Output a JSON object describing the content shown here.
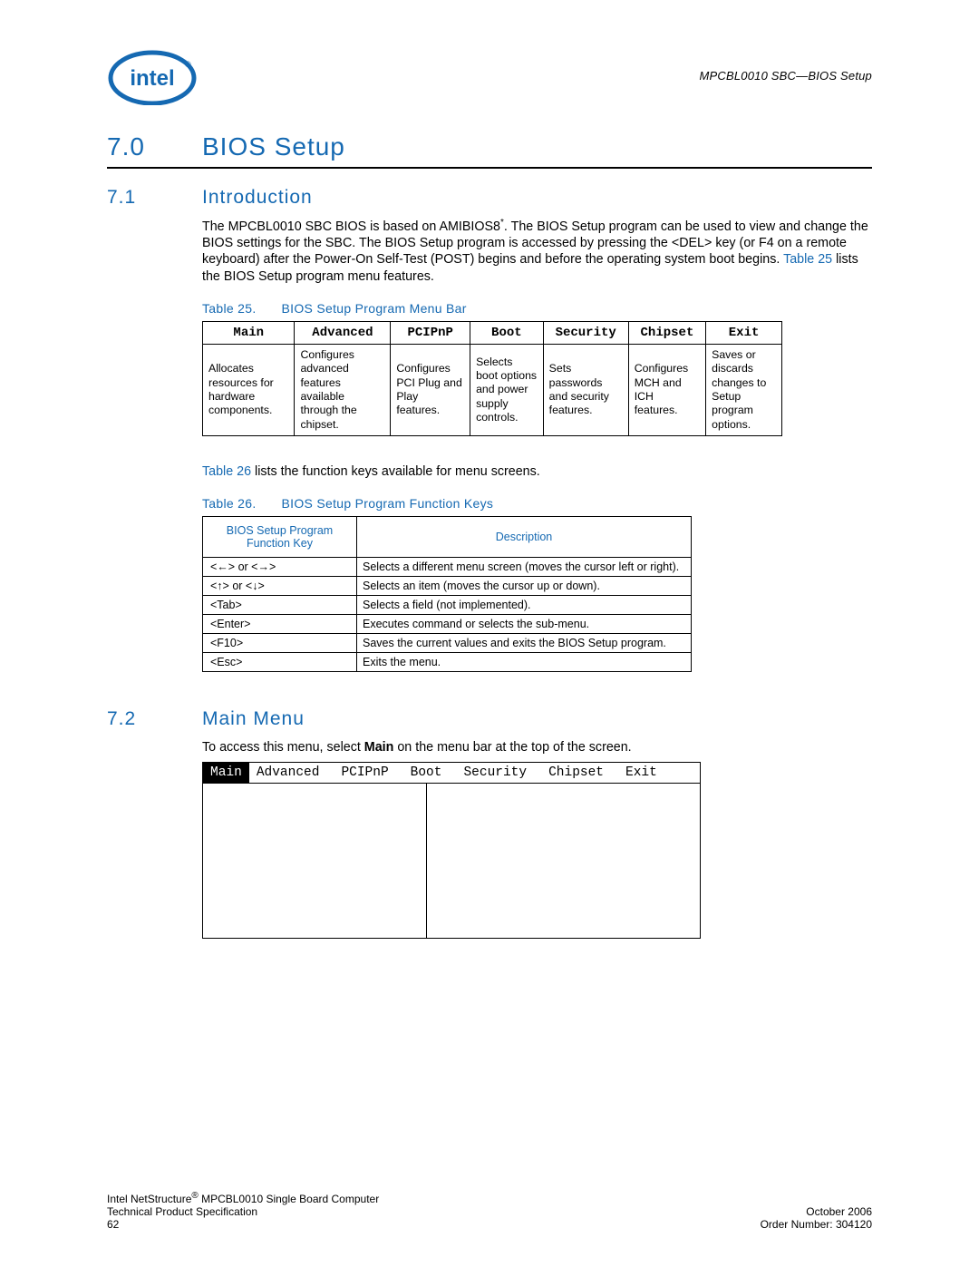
{
  "header": {
    "right": "MPCBL0010 SBC—BIOS Setup"
  },
  "h1": {
    "num": "7.0",
    "title": "BIOS Setup"
  },
  "sec71": {
    "num": "7.1",
    "title": "Introduction",
    "para_a": "The MPCBL0010 SBC BIOS is based on AMIBIOS8",
    "para_b": ". The BIOS Setup program can be used to view and change the BIOS settings for the SBC. The BIOS Setup program is accessed by pressing the <DEL> key (or F4 on a remote keyboard) after the Power-On Self-Test (POST) begins and before the operating system boot begins. ",
    "para_c": " lists the BIOS Setup program menu features.",
    "xref25": "Table 25",
    "sup": "*"
  },
  "table25": {
    "caption_num": "Table 25.",
    "caption_title": "BIOS Setup Program Menu Bar",
    "headers": [
      "Main",
      "Advanced",
      "PCIPnP",
      "Boot",
      "Security",
      "Chipset",
      "Exit"
    ],
    "cells": [
      "Allocates resources for hardware components.",
      "Configures advanced features available through the chipset.",
      "Configures PCI Plug and Play features.",
      "Selects boot options and power supply controls.",
      "Sets passwords and security features.",
      "Configures MCH and ICH features.",
      "Saves or discards changes to Setup program options."
    ]
  },
  "between": {
    "xref26": "Table 26",
    "text": " lists the function keys available for menu screens."
  },
  "table26": {
    "caption_num": "Table 26.",
    "caption_title": "BIOS Setup Program Function Keys",
    "header_key": "BIOS Setup Program Function Key",
    "header_desc": "Description",
    "rows": [
      {
        "key": "<←> or <→>",
        "desc": "Selects a different menu screen (moves the cursor left or right)."
      },
      {
        "key": "<↑> or <↓>",
        "desc": "Selects an item (moves the cursor up or down)."
      },
      {
        "key": "<Tab>",
        "desc": "Selects a field (not implemented)."
      },
      {
        "key": "<Enter>",
        "desc": "Executes command or selects the sub-menu."
      },
      {
        "key": "<F10>",
        "desc": "Saves the current values and exits the BIOS Setup program."
      },
      {
        "key": "<Esc>",
        "desc": "Exits the menu."
      }
    ]
  },
  "sec72": {
    "num": "7.2",
    "title": "Main Menu",
    "para_a": "To access this menu, select ",
    "para_b": "Main",
    "para_c": " on the menu bar at the top of the screen."
  },
  "bios_menu": {
    "tabs": [
      "Main",
      "Advanced",
      "PCIPnP",
      "Boot",
      "Security",
      "Chipset",
      "Exit"
    ]
  },
  "footer": {
    "line1_a": "Intel NetStructure",
    "line1_b": " MPCBL0010 Single Board Computer",
    "line2": "Technical Product Specification",
    "page": "62",
    "date": "October 2006",
    "order": "Order Number: 304120",
    "reg": "®"
  }
}
